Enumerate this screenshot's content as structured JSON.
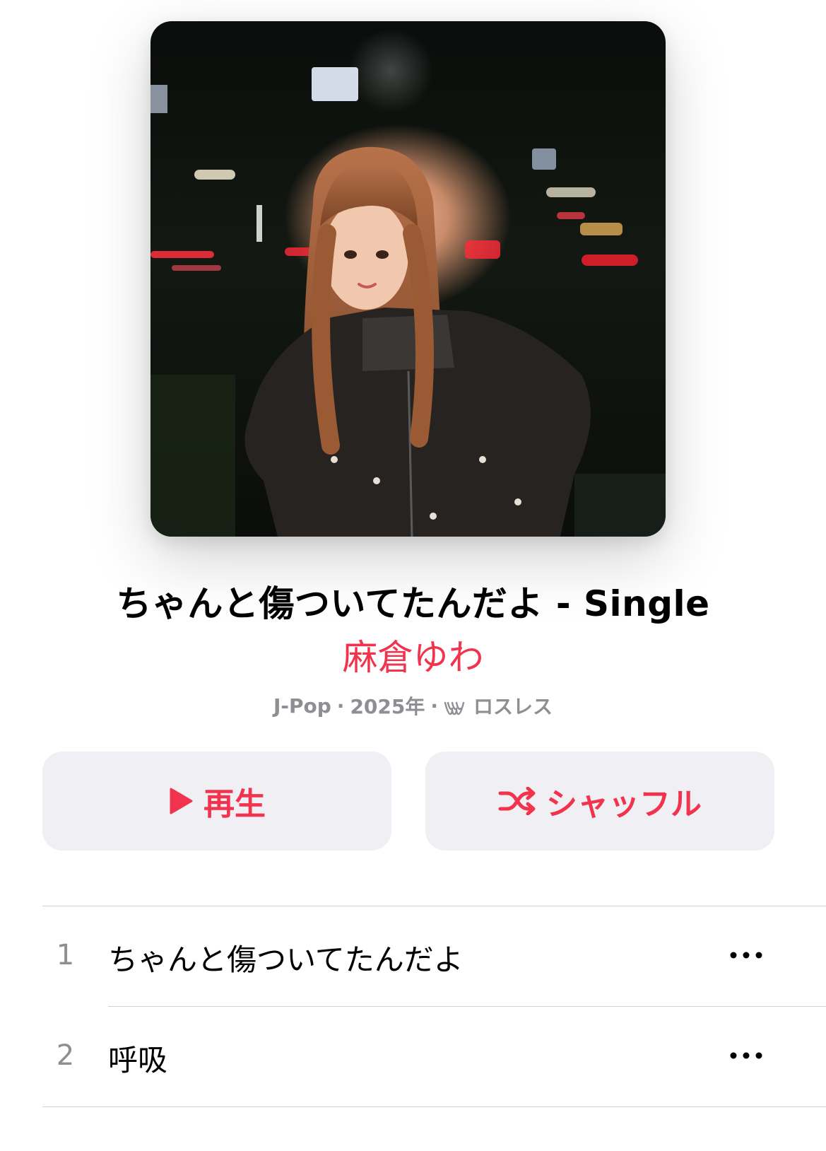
{
  "album": {
    "title": "ちゃんと傷ついてたんだよ - Single",
    "artist": "麻倉ゆわ",
    "genre": "J-Pop",
    "year": "2025年",
    "separator": "·",
    "quality_label": "ロスレス",
    "quality_icon": "lossless-icon"
  },
  "actions": {
    "play_label": "再生",
    "play_icon": "play-icon",
    "shuffle_label": "シャッフル",
    "shuffle_icon": "shuffle-icon"
  },
  "tracks": [
    {
      "number": "1",
      "title": "ちゃんと傷ついてたんだよ",
      "menu_icon": "more-icon"
    },
    {
      "number": "2",
      "title": "呼吸",
      "menu_icon": "more-icon"
    }
  ],
  "colors": {
    "accent": "#f2334d",
    "secondary_text": "#8e8e93",
    "button_background": "#f0f0f4",
    "divider": "#d1d1d6"
  }
}
